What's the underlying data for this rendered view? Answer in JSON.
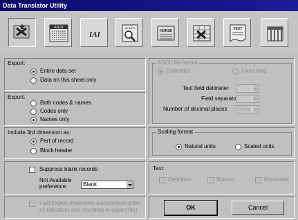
{
  "window": {
    "title": "Data Translator Utility"
  },
  "toolbar": {
    "buttons": [
      {
        "icon": "pointer-tool-icon",
        "pressed": true
      },
      {
        "icon": "ascii-file-icon",
        "label": "ASCII"
      },
      {
        "icon": "iai-file-icon",
        "label": "IAI"
      },
      {
        "icon": "magnify-document-icon",
        "label": "ID INFO"
      },
      {
        "icon": "horse-file-icon",
        "label": "HORSE"
      },
      {
        "icon": "export-sheet-icon"
      },
      {
        "icon": "text-file-icon",
        "label": "TEXT"
      },
      {
        "icon": "columns-icon"
      }
    ]
  },
  "export_scope": {
    "title": "Export:",
    "options": [
      "Entire data set",
      "Data on this sheet only"
    ],
    "selected": "Entire data set"
  },
  "export_content": {
    "title": "Export:",
    "options": [
      "Both codes & names",
      "Codes only",
      "Names only"
    ],
    "selected": "Names only"
  },
  "third_dimension": {
    "title": "Include 3rd dimension as:",
    "options": [
      "Part of record",
      "Block header"
    ],
    "selected": "Part of record"
  },
  "suppress": {
    "label": "Suppress blank records",
    "checked": false,
    "na_label_line1": "Not Available",
    "na_label_line2": "preference",
    "na_value": "Blank"
  },
  "fast_export": {
    "label_line1": "Fast Export (maintains alphabetical order",
    "label_line2": "of indicators and countries in export file)",
    "checked": false
  },
  "ascii_format": {
    "title": "ASCII file format",
    "delimited": "Delimited",
    "fixed": "Fixed field",
    "text_delim_label": "Text field delimeter",
    "text_delim_value": "\"",
    "field_sep_label": "Field separator",
    "field_sep_value": ",",
    "decimals_label": "Number of decimal places",
    "decimals_value": "Default"
  },
  "scaling": {
    "title": "Scaling format",
    "options": [
      "Natural units",
      "Scaled units"
    ],
    "selected": "Natural units"
  },
  "text_opts": {
    "title": "Text:",
    "options": [
      "Definition",
      "Source",
      "Footnotes"
    ]
  },
  "actions": {
    "ok": "OK",
    "cancel": "Cancel"
  }
}
